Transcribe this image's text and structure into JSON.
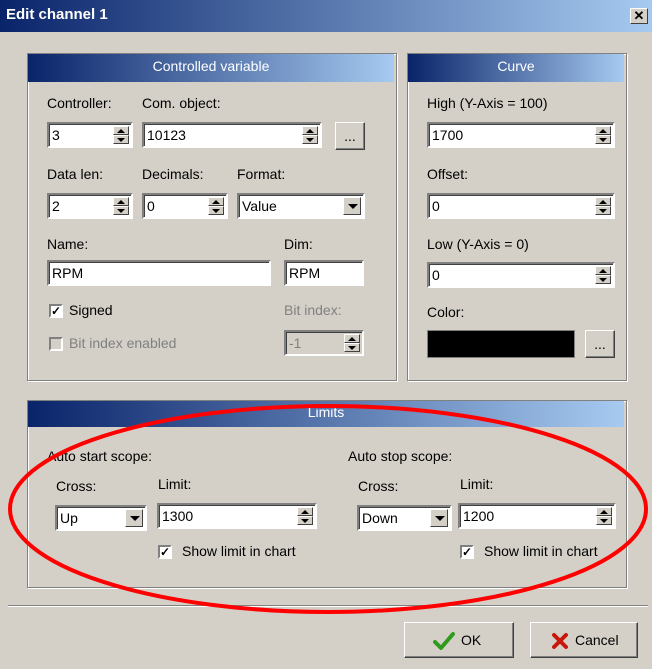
{
  "window": {
    "title": "Edit channel 1",
    "close_glyph": "✕"
  },
  "controlled": {
    "header": "Controlled variable",
    "controller_label": "Controller:",
    "controller_value": "3",
    "comobj_label": "Com. object:",
    "comobj_value": "10123",
    "browse_label": "...",
    "datalen_label": "Data len:",
    "datalen_value": "2",
    "decimals_label": "Decimals:",
    "decimals_value": "0",
    "format_label": "Format:",
    "format_value": "Value",
    "name_label": "Name:",
    "name_value": "RPM",
    "dim_label": "Dim:",
    "dim_value": "RPM",
    "signed_label": "Signed",
    "signed_checked": true,
    "bitindex_label": "Bit index:",
    "bitindex_value": "-1",
    "bitindex_enabled_label": "Bit index enabled",
    "bitindex_enabled_checked": false
  },
  "curve": {
    "header": "Curve",
    "high_label": "High (Y-Axis = 100)",
    "high_value": "1700",
    "offset_label": "Offset:",
    "offset_value": "0",
    "low_label": "Low (Y-Axis = 0)",
    "low_value": "0",
    "color_label": "Color:",
    "color_value": "#000000",
    "color_browse_label": "..."
  },
  "limits": {
    "header": "Limits",
    "start": {
      "title": "Auto start scope:",
      "cross_label": "Cross:",
      "cross_value": "Up",
      "limit_label": "Limit:",
      "limit_value": "1300",
      "show_label": "Show limit in chart",
      "show_checked": true
    },
    "stop": {
      "title": "Auto stop scope:",
      "cross_label": "Cross:",
      "cross_value": "Down",
      "limit_label": "Limit:",
      "limit_value": "1200",
      "show_label": "Show limit in chart",
      "show_checked": true
    }
  },
  "buttons": {
    "ok_label": "OK",
    "cancel_label": "Cancel"
  },
  "icons": {
    "ok_icon": "check-icon",
    "cancel_icon": "x-icon"
  },
  "annotation": {
    "color": "#ff0000",
    "shape": "ellipse"
  }
}
